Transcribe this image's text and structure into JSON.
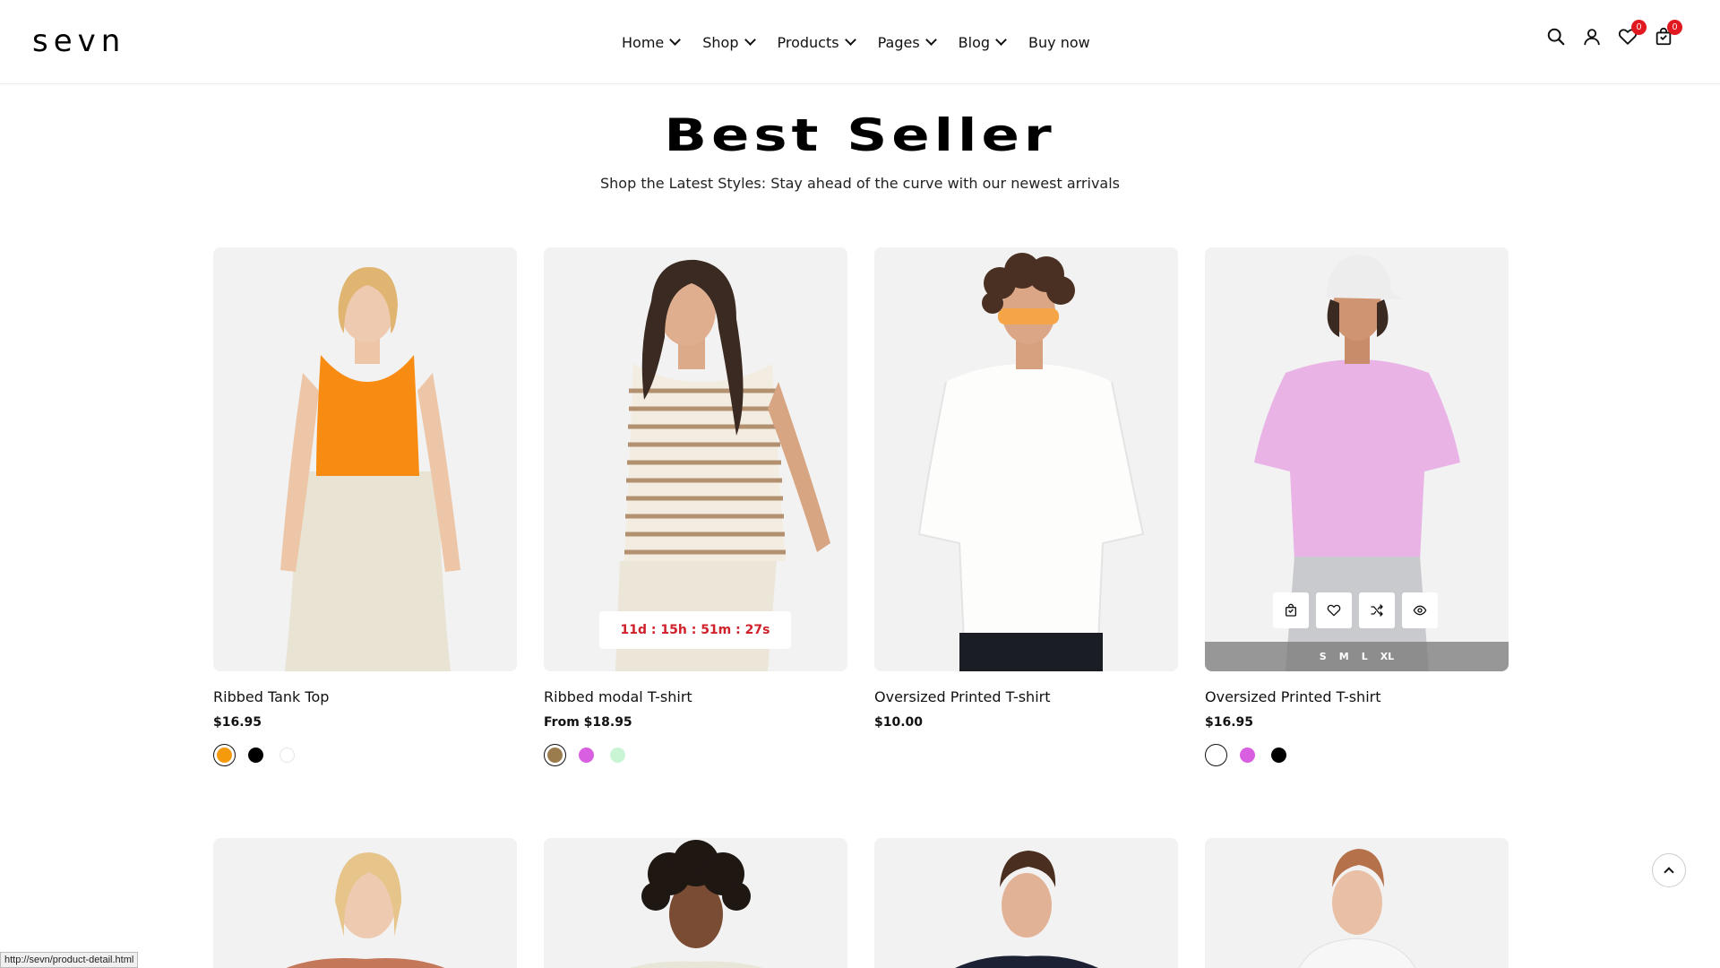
{
  "header": {
    "logo": "sevn",
    "nav": [
      {
        "label": "Home",
        "dropdown": true
      },
      {
        "label": "Shop",
        "dropdown": true
      },
      {
        "label": "Products",
        "dropdown": true
      },
      {
        "label": "Pages",
        "dropdown": true
      },
      {
        "label": "Blog",
        "dropdown": true
      },
      {
        "label": "Buy now",
        "dropdown": false
      }
    ],
    "wishlist_count": "0",
    "cart_count": "0"
  },
  "section": {
    "title": "Best Seller",
    "subtitle": "Shop the Latest Styles: Stay ahead of the curve with our newest arrivals"
  },
  "products": [
    {
      "name": "Ribbed Tank Top",
      "price": "$16.95",
      "swatches": [
        "#f59a0a",
        "#000000",
        "#ffffff"
      ],
      "active_swatch": 0
    },
    {
      "name": "Ribbed modal T-shirt",
      "price": "From $18.95",
      "countdown": "11d : 15h : 51m : 27s",
      "swatches": [
        "#9b7c4c",
        "#d860e0",
        "#c9f5d4"
      ],
      "active_swatch": 0
    },
    {
      "name": "Oversized Printed T-shirt",
      "price": "$10.00",
      "swatches": []
    },
    {
      "name": "Oversized Printed T-shirt",
      "price": "$16.95",
      "swatches": [
        "#ffffff",
        "#d860e0",
        "#000000"
      ],
      "active_swatch": 0,
      "sizes": [
        "S",
        "M",
        "L",
        "XL"
      ]
    }
  ],
  "status_bar_url": "http://sevn/product-detail.html",
  "colors": {
    "badge": "#e1181f",
    "countdown_text": "#d0202a",
    "card_bg": "#f2f2f2"
  }
}
